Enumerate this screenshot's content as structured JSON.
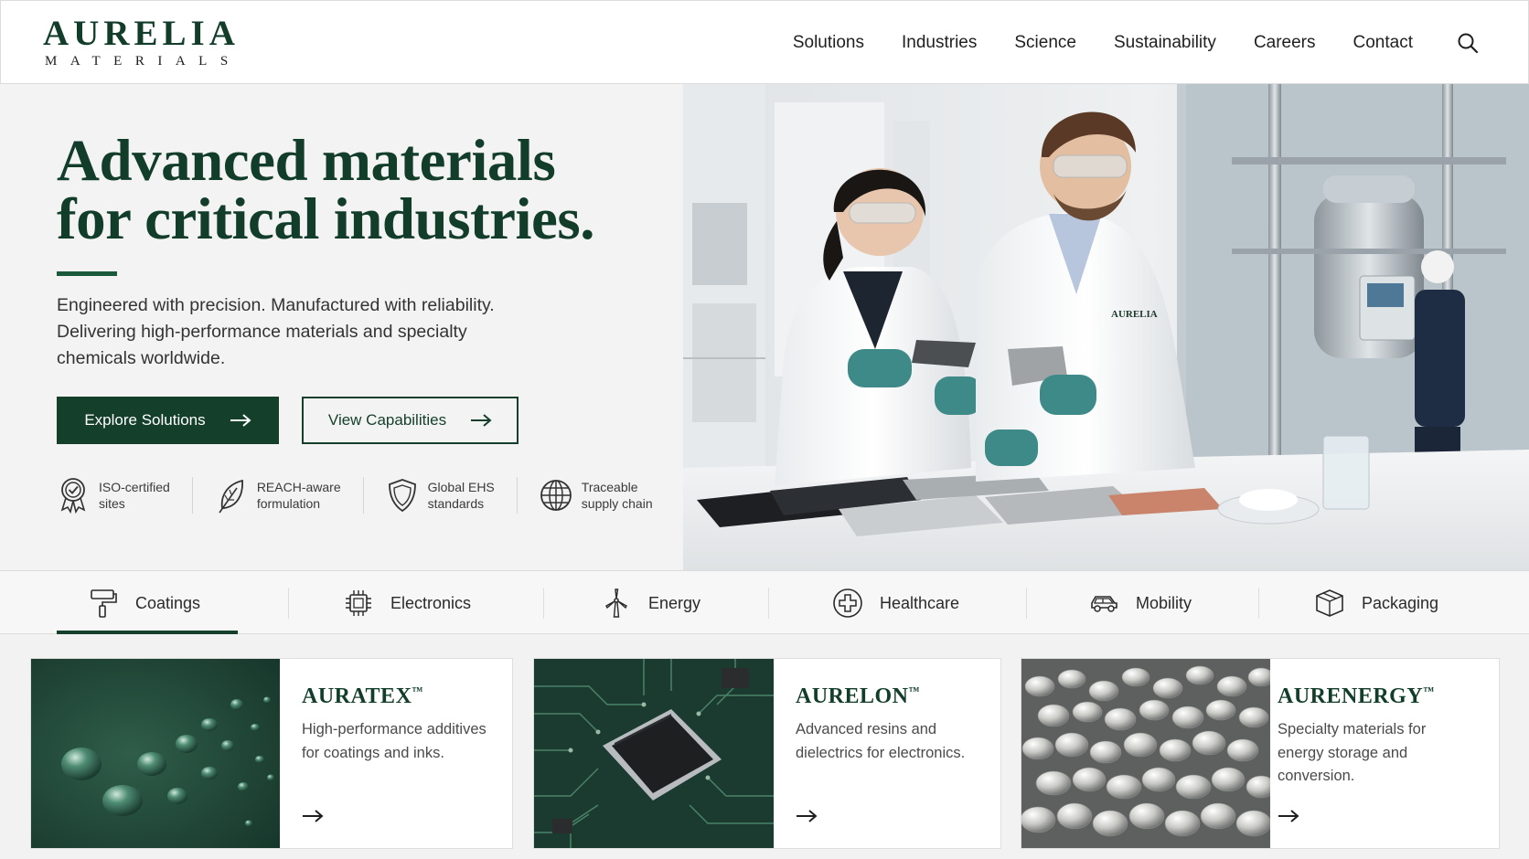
{
  "brand": {
    "name": "AURELIA",
    "sub": "MATERIALS",
    "badge_on_coat": "AURELIA MATERIALS"
  },
  "nav": {
    "items": [
      "Solutions",
      "Industries",
      "Science",
      "Sustainability",
      "Careers",
      "Contact"
    ],
    "search_icon": "search-icon"
  },
  "hero": {
    "title_line1": "Advanced materials",
    "title_line2": "for critical industries.",
    "text": "Engineered with precision. Manufactured with reliability. Delivering high-performance materials and specialty chemicals worldwide.",
    "primary_button": "Explore Solutions",
    "secondary_button": "View Capabilities",
    "badges": [
      {
        "icon": "certificate-icon",
        "line1": "ISO-certified",
        "line2": "sites"
      },
      {
        "icon": "leaf-icon",
        "line1": "REACH-aware",
        "line2": "formulation"
      },
      {
        "icon": "shield-icon",
        "line1": "Global EHS",
        "line2": "standards"
      },
      {
        "icon": "globe-icon",
        "line1": "Traceable",
        "line2": "supply chain"
      }
    ]
  },
  "tabs": [
    {
      "label": "Coatings",
      "icon": "paint-roller-icon",
      "active": true
    },
    {
      "label": "Electronics",
      "icon": "chip-icon"
    },
    {
      "label": "Energy",
      "icon": "wind-turbine-icon"
    },
    {
      "label": "Healthcare",
      "icon": "medical-cross-icon"
    },
    {
      "label": "Mobility",
      "icon": "car-icon"
    },
    {
      "label": "Packaging",
      "icon": "box-icon"
    }
  ],
  "cards": [
    {
      "title": "AURATEX",
      "tm": "™",
      "desc_line1": "High-performance additives",
      "desc_line2": "for coatings and inks.",
      "desc_line3": ""
    },
    {
      "title": "AURELON",
      "tm": "™",
      "desc_line1": "Advanced resins and",
      "desc_line2": "dielectrics for electronics.",
      "desc_line3": ""
    },
    {
      "title": "AURENERGY",
      "tm": "™",
      "desc_line1": "Specialty materials for",
      "desc_line2": "energy storage and",
      "desc_line3": "conversion."
    }
  ],
  "colors": {
    "brand_green": "#143f2b",
    "accent_green": "#1a5a3a",
    "background": "#f3f3f3"
  }
}
